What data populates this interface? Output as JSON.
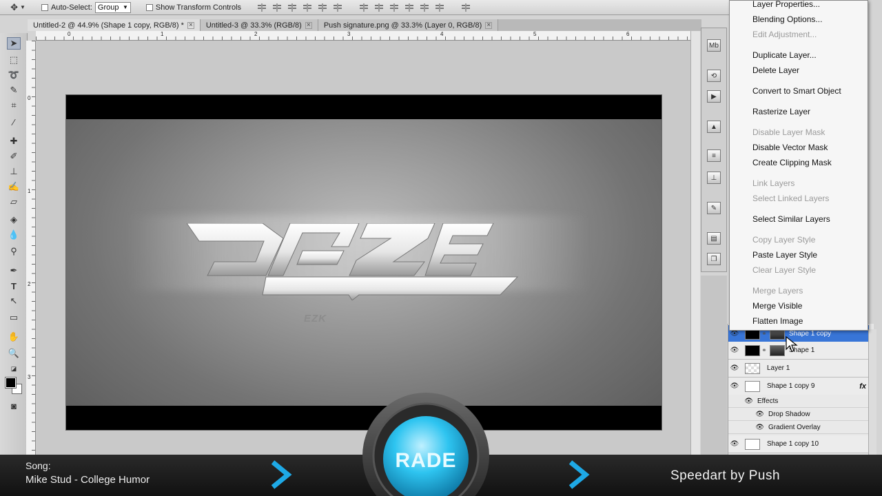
{
  "options_bar": {
    "auto_select_label": "Auto-Select:",
    "auto_select_value": "Group",
    "transform_controls_label": "Show Transform Controls"
  },
  "tabs": [
    {
      "label": "Untitled-2 @ 44.9% (Shape 1 copy, RGB/8) *",
      "active": true
    },
    {
      "label": "Untitled-3 @ 33.3% (RGB/8)",
      "active": false
    },
    {
      "label": "Push signature.png @ 33.3% (Layer 0, RGB/8)",
      "active": false
    }
  ],
  "ruler": {
    "h_ticks": [
      "0",
      "1",
      "2",
      "3",
      "4",
      "5",
      "6"
    ],
    "v_ticks": [
      "0",
      "1",
      "2",
      "3"
    ]
  },
  "canvas": {
    "logo_text": "DAZE",
    "sub_text": "EZK"
  },
  "context_menu": {
    "items": [
      {
        "label": "Layer Properties...",
        "enabled": true
      },
      {
        "label": "Blending Options...",
        "enabled": true
      },
      {
        "label": "Edit Adjustment...",
        "enabled": false
      },
      {
        "label": "Duplicate Layer...",
        "enabled": true
      },
      {
        "label": "Delete Layer",
        "enabled": true
      },
      {
        "label": "Convert to Smart Object",
        "enabled": true
      },
      {
        "label": "Rasterize Layer",
        "enabled": true
      },
      {
        "label": "Disable Layer Mask",
        "enabled": false
      },
      {
        "label": "Disable Vector Mask",
        "enabled": true
      },
      {
        "label": "Create Clipping Mask",
        "enabled": true
      },
      {
        "label": "Link Layers",
        "enabled": false
      },
      {
        "label": "Select Linked Layers",
        "enabled": false
      },
      {
        "label": "Select Similar Layers",
        "enabled": true
      },
      {
        "label": "Copy Layer Style",
        "enabled": false
      },
      {
        "label": "Paste Layer Style",
        "enabled": true
      },
      {
        "label": "Clear Layer Style",
        "enabled": false
      },
      {
        "label": "Merge Layers",
        "enabled": false
      },
      {
        "label": "Merge Visible",
        "enabled": true
      },
      {
        "label": "Flatten Image",
        "enabled": true
      }
    ]
  },
  "layers": {
    "rows": [
      {
        "name": "Shape 1 copy",
        "selected": true
      },
      {
        "name": "Shape 1",
        "selected": false
      },
      {
        "name": "Layer 1",
        "selected": false
      },
      {
        "name": "Shape 1 copy 9",
        "selected": false,
        "fx": "fx"
      },
      {
        "name": "Shape 1 copy 10",
        "selected": false
      }
    ],
    "effects_label": "Effects",
    "effects": [
      "Drop Shadow",
      "Gradient Overlay"
    ]
  },
  "overlay": {
    "song_label": "Song:",
    "song_name": "Mike Stud - College Humor",
    "dock_text": "RADE",
    "credit": "Speedart by Push"
  },
  "colors": {
    "selection_blue": "#3875d7",
    "dock_cyan": "#29c3ee",
    "chevron_blue": "#1ea9e6"
  }
}
